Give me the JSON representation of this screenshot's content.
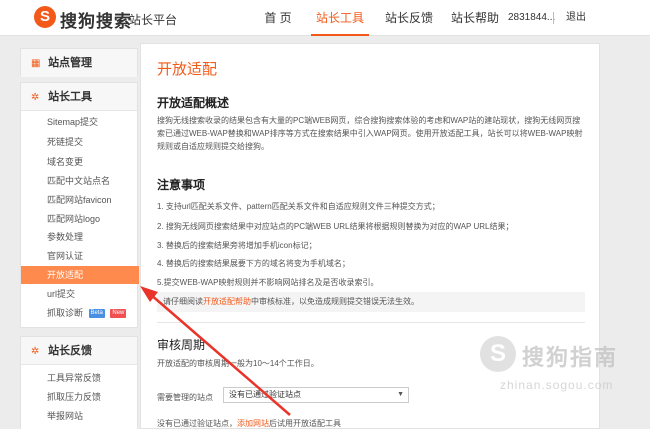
{
  "header": {
    "logo_glyph": "S",
    "brand": "搜狗搜索",
    "brand_sub": "站长平台",
    "nav": [
      "首 页",
      "站长工具",
      "站长反馈",
      "站长帮助"
    ],
    "user": "2831844...",
    "logout": "退出"
  },
  "sidebar": {
    "site_manage": {
      "title": "站点管理",
      "icon": "grid-icon"
    },
    "tools": {
      "title": "站长工具",
      "icon": "gear-icon",
      "items": [
        "Sitemap提交",
        "死链提交",
        "域名变更",
        "匹配中文站点名",
        "匹配网站favicon",
        "匹配网站logo",
        "参数处理",
        "官网认证",
        "开放适配",
        "url提交",
        "抓取诊断"
      ],
      "active_index": 8,
      "tags": [
        "Beta",
        "New"
      ]
    },
    "feedback": {
      "title": "站长反馈",
      "icon": "gear-icon",
      "items": [
        "工具异常反馈",
        "抓取压力反馈",
        "举报网站"
      ]
    }
  },
  "main": {
    "title": "开放适配",
    "overview_title": "开放适配概述",
    "overview_text": "搜狗无线搜索收录的结果包含有大量的PC端WEB网页，综合搜狗搜索体验的考虑和WAP站的建站现状，搜狗无线网页搜索已通过WEB-WAP替换和WAP排序等方式在搜索结果中引入WAP网页。使用开放适配工具，站长可以将WEB-WAP映射规则或自适应规则提交给搜狗。",
    "notes_title": "注意事项",
    "notes": [
      "1. 支持url匹配关系文件、pattern匹配关系文件和自适应规则文件三种提交方式；",
      "2. 搜狗无线网页搜索结果中对应站点的PC端WEB URL结果将根据规则替换为对应的WAP URL结果；",
      "3. 替换后的搜索结果旁将增加手机icon标记；",
      "4. 替换后的搜索结果展要下方的域名将变为手机域名；",
      "5.提交WEB-WAP映射规则并不影响网站排名及是否收录索引。"
    ],
    "tip_prefix": "请仔细阅读",
    "tip_link": "开放适配帮助",
    "tip_suffix": "中审核标准，以免造成规则提交错误无法生效。",
    "period_title": "审核周期",
    "period_text": "开放适配的审核周期一般为10～14个工作日。",
    "select_label": "需要管理的站点",
    "select_value": "没有已通过验证站点",
    "bottom_prefix": "没有已通过验证站点，",
    "bottom_link": "添加网站",
    "bottom_suffix": "后试用开放适配工具"
  },
  "watermark": {
    "logo_glyph": "S",
    "text": "搜狗指南",
    "url": "zhinan.sogou.com"
  },
  "colors": {
    "accent": "#f35a1a",
    "active_item": "#ff8a4d",
    "arrow": "#e8342a"
  }
}
